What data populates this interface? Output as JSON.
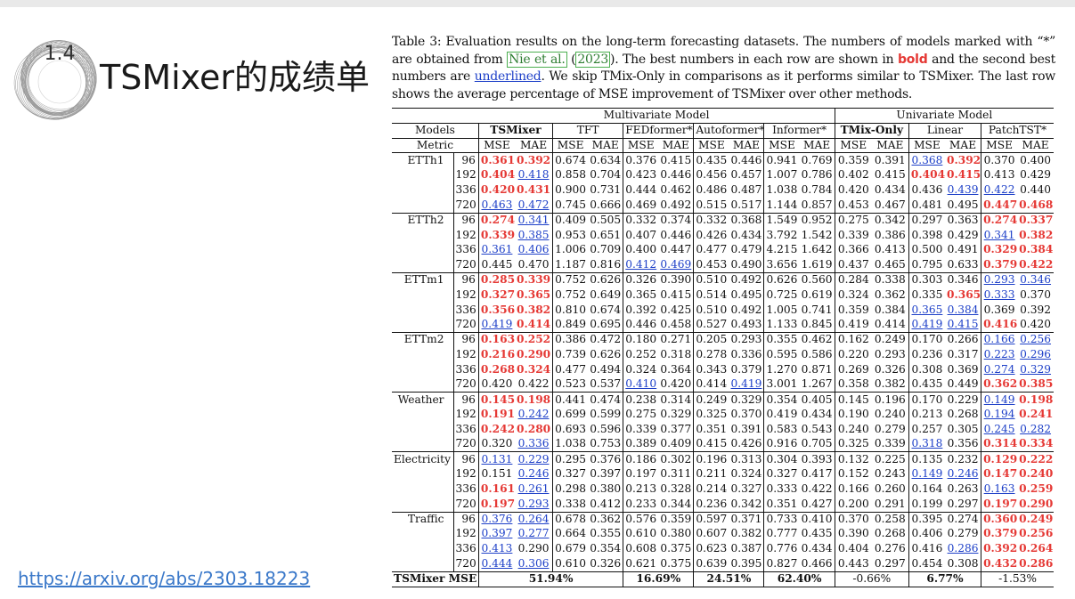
{
  "slide": {
    "section_number": "1.4",
    "title": "TSMixer的成绩单",
    "link": "https://arxiv.org/abs/2303.18223"
  },
  "caption": {
    "p1": "Table 3: Evaluation results on the long-term forecasting datasets. The numbers of models marked with “*” are obtained from ",
    "ref_authors": "Nie et al.",
    "p2": " (",
    "ref_year": "2023",
    "p3": "). The best numbers in each row are shown in ",
    "bold_word": "bold",
    "p4": " and the second best numbers are ",
    "underlined_word": "underlined",
    "p5": ". We skip TMix-Only in comparisons as it performs similar to TSMixer. The last row shows the average percentage of MSE improvement of TSMixer over other methods."
  },
  "colors": {
    "best": "#e53935",
    "second_best": "#1e40c8",
    "citation": "#2e7d32"
  },
  "table": {
    "group_multivariate": "Multivariate Model",
    "group_univariate": "Univariate Model",
    "models_label": "Models",
    "metric_label": "Metric",
    "models": [
      "TSMixer",
      "TFT",
      "FEDformer*",
      "Autoformer*",
      "Informer*",
      "TMix-Only",
      "Linear",
      "PatchTST*"
    ],
    "metrics": [
      "MSE",
      "MAE"
    ],
    "datasets": [
      {
        "name": "ETTh1",
        "rows": [
          {
            "h": "96",
            "v": [
              "0.361|b",
              "0.392|b",
              "0.674",
              "0.634",
              "0.376",
              "0.415",
              "0.435",
              "0.446",
              "0.941",
              "0.769",
              "0.359",
              "0.391",
              "0.368|u",
              "0.392|b",
              "0.370",
              "0.400"
            ]
          },
          {
            "h": "192",
            "v": [
              "0.404|b",
              "0.418|u",
              "0.858",
              "0.704",
              "0.423",
              "0.446",
              "0.456",
              "0.457",
              "1.007",
              "0.786",
              "0.402",
              "0.415",
              "0.404|b",
              "0.415|b",
              "0.413",
              "0.429"
            ]
          },
          {
            "h": "336",
            "v": [
              "0.420|b",
              "0.431|b",
              "0.900",
              "0.731",
              "0.444",
              "0.462",
              "0.486",
              "0.487",
              "1.038",
              "0.784",
              "0.420",
              "0.434",
              "0.436",
              "0.439|u",
              "0.422|u",
              "0.440"
            ]
          },
          {
            "h": "720",
            "v": [
              "0.463|u",
              "0.472|u",
              "0.745",
              "0.666",
              "0.469",
              "0.492",
              "0.515",
              "0.517",
              "1.144",
              "0.857",
              "0.453",
              "0.467",
              "0.481",
              "0.495",
              "0.447|b",
              "0.468|b"
            ]
          }
        ]
      },
      {
        "name": "ETTh2",
        "rows": [
          {
            "h": "96",
            "v": [
              "0.274|b",
              "0.341|u",
              "0.409",
              "0.505",
              "0.332",
              "0.374",
              "0.332",
              "0.368",
              "1.549",
              "0.952",
              "0.275",
              "0.342",
              "0.297",
              "0.363",
              "0.274|b",
              "0.337|b"
            ]
          },
          {
            "h": "192",
            "v": [
              "0.339|b",
              "0.385|u",
              "0.953",
              "0.651",
              "0.407",
              "0.446",
              "0.426",
              "0.434",
              "3.792",
              "1.542",
              "0.339",
              "0.386",
              "0.398",
              "0.429",
              "0.341|u",
              "0.382|b"
            ]
          },
          {
            "h": "336",
            "v": [
              "0.361|u",
              "0.406|u",
              "1.006",
              "0.709",
              "0.400",
              "0.447",
              "0.477",
              "0.479",
              "4.215",
              "1.642",
              "0.366",
              "0.413",
              "0.500",
              "0.491",
              "0.329|b",
              "0.384|b"
            ]
          },
          {
            "h": "720",
            "v": [
              "0.445",
              "0.470",
              "1.187",
              "0.816",
              "0.412|u",
              "0.469|u",
              "0.453",
              "0.490",
              "3.656",
              "1.619",
              "0.437",
              "0.465",
              "0.795",
              "0.633",
              "0.379|b",
              "0.422|b"
            ]
          }
        ]
      },
      {
        "name": "ETTm1",
        "rows": [
          {
            "h": "96",
            "v": [
              "0.285|b",
              "0.339|b",
              "0.752",
              "0.626",
              "0.326",
              "0.390",
              "0.510",
              "0.492",
              "0.626",
              "0.560",
              "0.284",
              "0.338",
              "0.303",
              "0.346",
              "0.293|u",
              "0.346|u"
            ]
          },
          {
            "h": "192",
            "v": [
              "0.327|b",
              "0.365|b",
              "0.752",
              "0.649",
              "0.365",
              "0.415",
              "0.514",
              "0.495",
              "0.725",
              "0.619",
              "0.324",
              "0.362",
              "0.335",
              "0.365|b",
              "0.333|u",
              "0.370"
            ]
          },
          {
            "h": "336",
            "v": [
              "0.356|b",
              "0.382|b",
              "0.810",
              "0.674",
              "0.392",
              "0.425",
              "0.510",
              "0.492",
              "1.005",
              "0.741",
              "0.359",
              "0.384",
              "0.365|u",
              "0.384|u",
              "0.369",
              "0.392"
            ]
          },
          {
            "h": "720",
            "v": [
              "0.419|u",
              "0.414|b",
              "0.849",
              "0.695",
              "0.446",
              "0.458",
              "0.527",
              "0.493",
              "1.133",
              "0.845",
              "0.419",
              "0.414",
              "0.419|u",
              "0.415|u",
              "0.416|b",
              "0.420"
            ]
          }
        ]
      },
      {
        "name": "ETTm2",
        "rows": [
          {
            "h": "96",
            "v": [
              "0.163|b",
              "0.252|b",
              "0.386",
              "0.472",
              "0.180",
              "0.271",
              "0.205",
              "0.293",
              "0.355",
              "0.462",
              "0.162",
              "0.249",
              "0.170",
              "0.266",
              "0.166|u",
              "0.256|u"
            ]
          },
          {
            "h": "192",
            "v": [
              "0.216|b",
              "0.290|b",
              "0.739",
              "0.626",
              "0.252",
              "0.318",
              "0.278",
              "0.336",
              "0.595",
              "0.586",
              "0.220",
              "0.293",
              "0.236",
              "0.317",
              "0.223|u",
              "0.296|u"
            ]
          },
          {
            "h": "336",
            "v": [
              "0.268|b",
              "0.324|b",
              "0.477",
              "0.494",
              "0.324",
              "0.364",
              "0.343",
              "0.379",
              "1.270",
              "0.871",
              "0.269",
              "0.326",
              "0.308",
              "0.369",
              "0.274|u",
              "0.329|u"
            ]
          },
          {
            "h": "720",
            "v": [
              "0.420",
              "0.422",
              "0.523",
              "0.537",
              "0.410|u",
              "0.420",
              "0.414",
              "0.419|u",
              "3.001",
              "1.267",
              "0.358",
              "0.382",
              "0.435",
              "0.449",
              "0.362|b",
              "0.385|b"
            ]
          }
        ]
      },
      {
        "name": "Weather",
        "rows": [
          {
            "h": "96",
            "v": [
              "0.145|b",
              "0.198|b",
              "0.441",
              "0.474",
              "0.238",
              "0.314",
              "0.249",
              "0.329",
              "0.354",
              "0.405",
              "0.145",
              "0.196",
              "0.170",
              "0.229",
              "0.149|u",
              "0.198|b"
            ]
          },
          {
            "h": "192",
            "v": [
              "0.191|b",
              "0.242|u",
              "0.699",
              "0.599",
              "0.275",
              "0.329",
              "0.325",
              "0.370",
              "0.419",
              "0.434",
              "0.190",
              "0.240",
              "0.213",
              "0.268",
              "0.194|u",
              "0.241|b"
            ]
          },
          {
            "h": "336",
            "v": [
              "0.242|b",
              "0.280|b",
              "0.693",
              "0.596",
              "0.339",
              "0.377",
              "0.351",
              "0.391",
              "0.583",
              "0.543",
              "0.240",
              "0.279",
              "0.257",
              "0.305",
              "0.245|u",
              "0.282|u"
            ]
          },
          {
            "h": "720",
            "v": [
              "0.320",
              "0.336|u",
              "1.038",
              "0.753",
              "0.389",
              "0.409",
              "0.415",
              "0.426",
              "0.916",
              "0.705",
              "0.325",
              "0.339",
              "0.318|u",
              "0.356",
              "0.314|b",
              "0.334|b"
            ]
          }
        ]
      },
      {
        "name": "Electricity",
        "rows": [
          {
            "h": "96",
            "v": [
              "0.131|u",
              "0.229|u",
              "0.295",
              "0.376",
              "0.186",
              "0.302",
              "0.196",
              "0.313",
              "0.304",
              "0.393",
              "0.132",
              "0.225",
              "0.135",
              "0.232",
              "0.129|b",
              "0.222|b"
            ]
          },
          {
            "h": "192",
            "v": [
              "0.151",
              "0.246|u",
              "0.327",
              "0.397",
              "0.197",
              "0.311",
              "0.211",
              "0.324",
              "0.327",
              "0.417",
              "0.152",
              "0.243",
              "0.149|u",
              "0.246|u",
              "0.147|b",
              "0.240|b"
            ]
          },
          {
            "h": "336",
            "v": [
              "0.161|b",
              "0.261|u",
              "0.298",
              "0.380",
              "0.213",
              "0.328",
              "0.214",
              "0.327",
              "0.333",
              "0.422",
              "0.166",
              "0.260",
              "0.164",
              "0.263",
              "0.163|u",
              "0.259|b"
            ]
          },
          {
            "h": "720",
            "v": [
              "0.197|b",
              "0.293|u",
              "0.338",
              "0.412",
              "0.233",
              "0.344",
              "0.236",
              "0.342",
              "0.351",
              "0.427",
              "0.200",
              "0.291",
              "0.199",
              "0.297",
              "0.197|b",
              "0.290|b"
            ]
          }
        ]
      },
      {
        "name": "Traffic",
        "rows": [
          {
            "h": "96",
            "v": [
              "0.376|u",
              "0.264|u",
              "0.678",
              "0.362",
              "0.576",
              "0.359",
              "0.597",
              "0.371",
              "0.733",
              "0.410",
              "0.370",
              "0.258",
              "0.395",
              "0.274",
              "0.360|b",
              "0.249|b"
            ]
          },
          {
            "h": "192",
            "v": [
              "0.397|u",
              "0.277|u",
              "0.664",
              "0.355",
              "0.610",
              "0.380",
              "0.607",
              "0.382",
              "0.777",
              "0.435",
              "0.390",
              "0.268",
              "0.406",
              "0.279",
              "0.379|b",
              "0.256|b"
            ]
          },
          {
            "h": "336",
            "v": [
              "0.413|u",
              "0.290",
              "0.679",
              "0.354",
              "0.608",
              "0.375",
              "0.623",
              "0.387",
              "0.776",
              "0.434",
              "0.404",
              "0.276",
              "0.416",
              "0.286|u",
              "0.392|b",
              "0.264|b"
            ]
          },
          {
            "h": "720",
            "v": [
              "0.444|u",
              "0.306|u",
              "0.610",
              "0.326",
              "0.621",
              "0.375",
              "0.639",
              "0.395",
              "0.827",
              "0.466",
              "0.443",
              "0.297",
              "0.454",
              "0.308",
              "0.432|b",
              "0.286|b"
            ]
          }
        ]
      }
    ],
    "improvement_label": "TSMixer MSE Imp.",
    "improvement": [
      "51.94%|b",
      "16.69%|b",
      "24.51%|b",
      "62.40%|b",
      "-0.66%",
      "6.77%|b",
      "-1.53%"
    ]
  }
}
